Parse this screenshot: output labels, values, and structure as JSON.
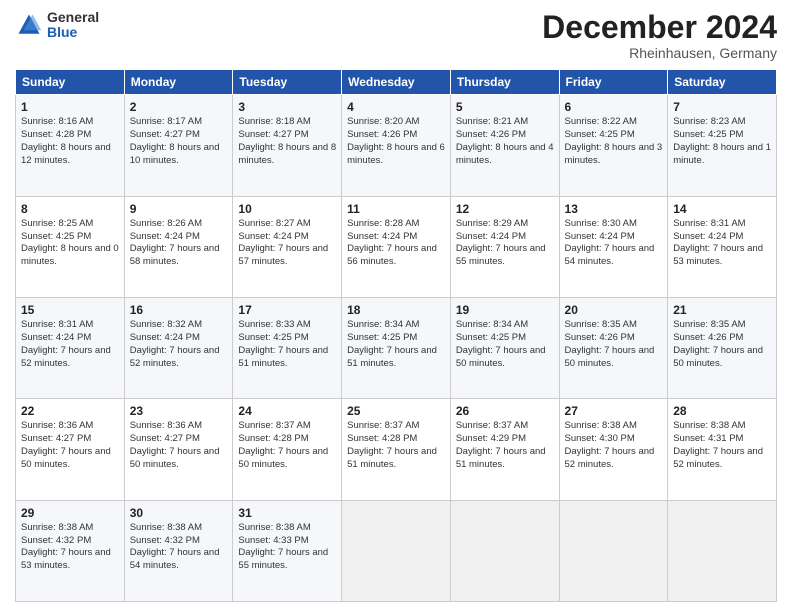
{
  "logo": {
    "general": "General",
    "blue": "Blue"
  },
  "header": {
    "title": "December 2024",
    "location": "Rheinhausen, Germany"
  },
  "weekdays": [
    "Sunday",
    "Monday",
    "Tuesday",
    "Wednesday",
    "Thursday",
    "Friday",
    "Saturday"
  ],
  "weeks": [
    [
      {
        "day": "1",
        "sunrise": "8:16 AM",
        "sunset": "4:28 PM",
        "daylight": "8 hours and 12 minutes."
      },
      {
        "day": "2",
        "sunrise": "8:17 AM",
        "sunset": "4:27 PM",
        "daylight": "8 hours and 10 minutes."
      },
      {
        "day": "3",
        "sunrise": "8:18 AM",
        "sunset": "4:27 PM",
        "daylight": "8 hours and 8 minutes."
      },
      {
        "day": "4",
        "sunrise": "8:20 AM",
        "sunset": "4:26 PM",
        "daylight": "8 hours and 6 minutes."
      },
      {
        "day": "5",
        "sunrise": "8:21 AM",
        "sunset": "4:26 PM",
        "daylight": "8 hours and 4 minutes."
      },
      {
        "day": "6",
        "sunrise": "8:22 AM",
        "sunset": "4:25 PM",
        "daylight": "8 hours and 3 minutes."
      },
      {
        "day": "7",
        "sunrise": "8:23 AM",
        "sunset": "4:25 PM",
        "daylight": "8 hours and 1 minute."
      }
    ],
    [
      {
        "day": "8",
        "sunrise": "8:25 AM",
        "sunset": "4:25 PM",
        "daylight": "8 hours and 0 minutes."
      },
      {
        "day": "9",
        "sunrise": "8:26 AM",
        "sunset": "4:24 PM",
        "daylight": "7 hours and 58 minutes."
      },
      {
        "day": "10",
        "sunrise": "8:27 AM",
        "sunset": "4:24 PM",
        "daylight": "7 hours and 57 minutes."
      },
      {
        "day": "11",
        "sunrise": "8:28 AM",
        "sunset": "4:24 PM",
        "daylight": "7 hours and 56 minutes."
      },
      {
        "day": "12",
        "sunrise": "8:29 AM",
        "sunset": "4:24 PM",
        "daylight": "7 hours and 55 minutes."
      },
      {
        "day": "13",
        "sunrise": "8:30 AM",
        "sunset": "4:24 PM",
        "daylight": "7 hours and 54 minutes."
      },
      {
        "day": "14",
        "sunrise": "8:31 AM",
        "sunset": "4:24 PM",
        "daylight": "7 hours and 53 minutes."
      }
    ],
    [
      {
        "day": "15",
        "sunrise": "8:31 AM",
        "sunset": "4:24 PM",
        "daylight": "7 hours and 52 minutes."
      },
      {
        "day": "16",
        "sunrise": "8:32 AM",
        "sunset": "4:24 PM",
        "daylight": "7 hours and 52 minutes."
      },
      {
        "day": "17",
        "sunrise": "8:33 AM",
        "sunset": "4:25 PM",
        "daylight": "7 hours and 51 minutes."
      },
      {
        "day": "18",
        "sunrise": "8:34 AM",
        "sunset": "4:25 PM",
        "daylight": "7 hours and 51 minutes."
      },
      {
        "day": "19",
        "sunrise": "8:34 AM",
        "sunset": "4:25 PM",
        "daylight": "7 hours and 50 minutes."
      },
      {
        "day": "20",
        "sunrise": "8:35 AM",
        "sunset": "4:26 PM",
        "daylight": "7 hours and 50 minutes."
      },
      {
        "day": "21",
        "sunrise": "8:35 AM",
        "sunset": "4:26 PM",
        "daylight": "7 hours and 50 minutes."
      }
    ],
    [
      {
        "day": "22",
        "sunrise": "8:36 AM",
        "sunset": "4:27 PM",
        "daylight": "7 hours and 50 minutes."
      },
      {
        "day": "23",
        "sunrise": "8:36 AM",
        "sunset": "4:27 PM",
        "daylight": "7 hours and 50 minutes."
      },
      {
        "day": "24",
        "sunrise": "8:37 AM",
        "sunset": "4:28 PM",
        "daylight": "7 hours and 50 minutes."
      },
      {
        "day": "25",
        "sunrise": "8:37 AM",
        "sunset": "4:28 PM",
        "daylight": "7 hours and 51 minutes."
      },
      {
        "day": "26",
        "sunrise": "8:37 AM",
        "sunset": "4:29 PM",
        "daylight": "7 hours and 51 minutes."
      },
      {
        "day": "27",
        "sunrise": "8:38 AM",
        "sunset": "4:30 PM",
        "daylight": "7 hours and 52 minutes."
      },
      {
        "day": "28",
        "sunrise": "8:38 AM",
        "sunset": "4:31 PM",
        "daylight": "7 hours and 52 minutes."
      }
    ],
    [
      {
        "day": "29",
        "sunrise": "8:38 AM",
        "sunset": "4:32 PM",
        "daylight": "7 hours and 53 minutes."
      },
      {
        "day": "30",
        "sunrise": "8:38 AM",
        "sunset": "4:32 PM",
        "daylight": "7 hours and 54 minutes."
      },
      {
        "day": "31",
        "sunrise": "8:38 AM",
        "sunset": "4:33 PM",
        "daylight": "7 hours and 55 minutes."
      },
      null,
      null,
      null,
      null
    ]
  ]
}
